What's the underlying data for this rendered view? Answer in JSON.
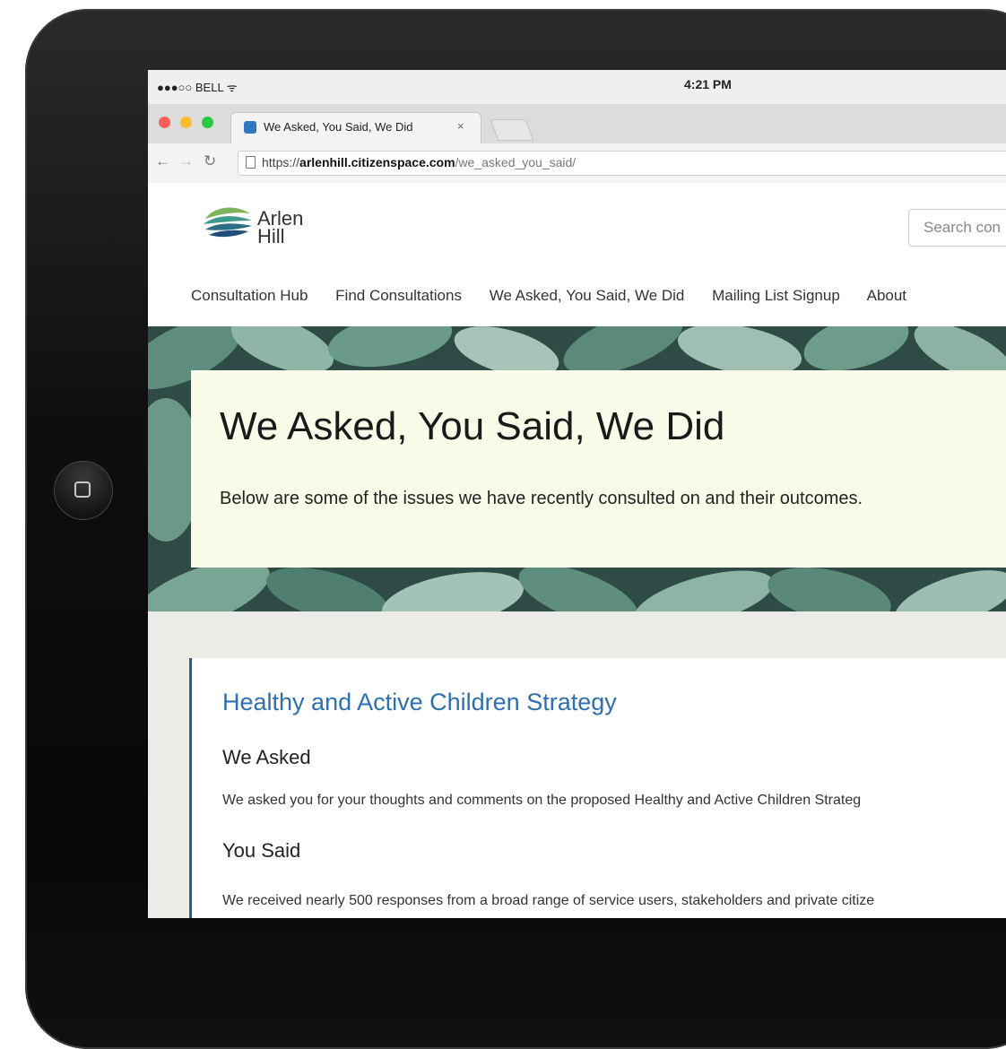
{
  "status_bar": {
    "carrier": "●●●○○ BELL ᯤ",
    "time": "4:21 PM"
  },
  "browser": {
    "tab_title": "We Asked, You Said, We Did",
    "tab_close": "×",
    "url_scheme": "https://",
    "url_domain": "arlenhill.citizenspace.com",
    "url_path": "/we_asked_you_said/"
  },
  "site": {
    "logo_line1": "Arlen",
    "logo_line2": "Hill",
    "search_placeholder": "Search con",
    "nav": [
      "Consultation Hub",
      "Find Consultations",
      "We Asked, You Said, We Did",
      "Mailing List Signup",
      "About"
    ]
  },
  "hero": {
    "title": "We Asked, You Said, We Did",
    "subtitle": "Below are some of the issues we have recently consulted on and their outcomes."
  },
  "card": {
    "title": "Healthy and Active Children Strategy",
    "we_asked_heading": "We Asked",
    "we_asked_text": "We asked you for your thoughts and comments on the proposed Healthy and Active Children Strateg",
    "you_said_heading": "You Said",
    "you_said_text": "We received nearly 500 responses from a broad range of service users, stakeholders and private citize"
  },
  "colors": {
    "link_blue": "#2d6fb0",
    "card_accent": "#2d5f86",
    "hero_panel": "#fbfbea"
  }
}
